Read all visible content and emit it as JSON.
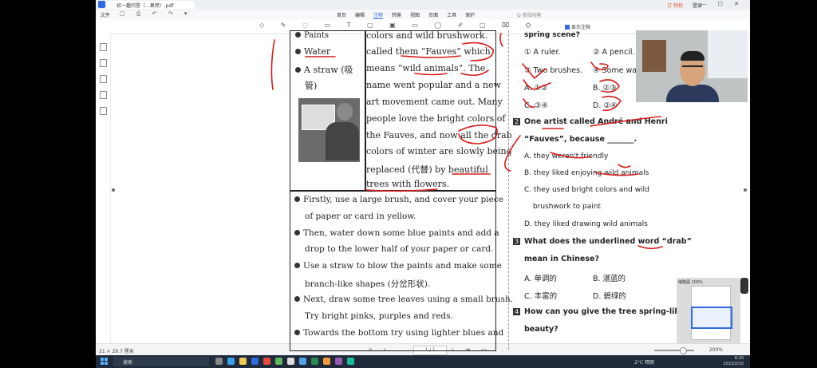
{
  "app": {
    "tab_title": "初一趣问答（...果然）.pdf",
    "title_right": [
      "订 特权",
      "登录"
    ],
    "file_menu": "文件",
    "menus": [
      "首页",
      "编辑",
      "注释",
      "转换",
      "视图",
      "页面",
      "工具",
      "保护"
    ],
    "active_menu": "注释",
    "search_placeholder": "Q 查找功能",
    "show_notes_label": "显示注释",
    "thumbnail_label": "缩略图 200%",
    "page_size": "21 × 29.7 厘米",
    "page_indicator": "1 / 1",
    "zoom": "200%",
    "window_controls": "— ☐ ✕"
  },
  "document": {
    "left_col_top": [
      {
        "text": "Paints",
        "bullet": true
      },
      {
        "text": "Water",
        "bullet": true
      },
      {
        "text": "A straw (吸",
        "bullet": true
      },
      {
        "text": "管)",
        "bullet": false
      }
    ],
    "right_col_top": [
      "colors and wild brushwork.",
      "called them “Fauves” which",
      "means “wild animals”. The",
      "name went popular and a new",
      "art movement came out. Many",
      "people love the bright colors of",
      "the Fauves, and now all the drab",
      "colors of winter are slowly being",
      "replaced (代替) by beautiful",
      "trees with flowers."
    ],
    "steps": [
      {
        "text": "Firstly, use a large brush, and cover your piece",
        "bullet": true
      },
      {
        "text": "of paper or card in yellow.",
        "bullet": false
      },
      {
        "text": "Then, water down some blue paints and add a",
        "bullet": true
      },
      {
        "text": "drop to the lower half of your paper or card.",
        "bullet": false
      },
      {
        "text": "Use a straw to blow the paints and make some",
        "bullet": true
      },
      {
        "text": "branch-like shapes (分岔形状).",
        "bullet": false
      },
      {
        "text": "Next, draw some tree leaves using a small brush.",
        "bullet": true
      },
      {
        "text": "Try bright pinks, purples and reds.",
        "bullet": false
      },
      {
        "text": "Towards the bottom try using lighter blues and",
        "bullet": true
      }
    ],
    "questions": {
      "q1_tail": "spring scene?",
      "q1_options": [
        [
          "① A ruler.",
          "② A pencil."
        ],
        [
          "③ Two brushes.",
          "④ Some wa"
        ]
      ],
      "q1_answers": [
        [
          "A. ①②",
          "B. ②③"
        ],
        [
          "C. ③④",
          "D. ②④"
        ]
      ],
      "q2_num": "2",
      "q2_stem": [
        "One artist called André and Henri",
        "“Fauves”, because _______."
      ],
      "q2_options": [
        "A. they weren't friendly",
        "B. they liked enjoying wild animals",
        "C. they used bright colors and wild",
        "brushwork to paint",
        "D. they liked drawing wild animals"
      ],
      "q3_num": "3",
      "q3_stem": [
        "What does the underlined word “drab”",
        "mean in Chinese?"
      ],
      "q3_options": [
        [
          "A. 单调的",
          "B. 湛蓝的"
        ],
        [
          "C. 丰富的",
          "D. 碧绿的"
        ]
      ],
      "q4_num": "4",
      "q4_stem": [
        "How can you give the tree spring-like",
        "beauty?"
      ]
    }
  },
  "taskbar": {
    "search_placeholder": "搜索",
    "weather": "2°C 晴朗",
    "time": "8:20",
    "date": "2023/2/15"
  },
  "colors": {
    "annotation_red": "#d91c1c",
    "accent": "#2d6ae3"
  }
}
